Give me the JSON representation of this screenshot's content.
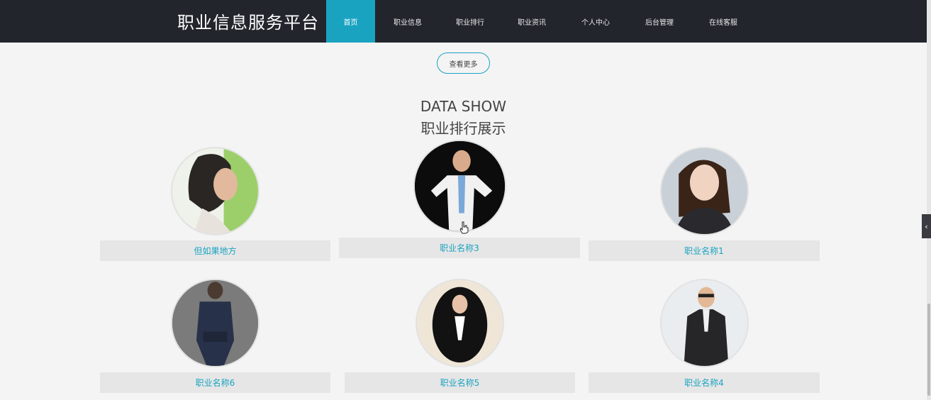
{
  "header": {
    "brand": "职业信息服务平台",
    "nav": [
      "首页",
      "职业信息",
      "职业排行",
      "职业资讯",
      "个人中心",
      "后台管理",
      "在线客服"
    ],
    "active_index": 0
  },
  "main": {
    "more_button": "查看更多",
    "section_title_en": "DATA SHOW",
    "section_title_zh": "职业排行展示",
    "cards": [
      {
        "label": "但如果地方",
        "icon": "person-photo-icon"
      },
      {
        "label": "职业名称3",
        "icon": "person-photo-icon"
      },
      {
        "label": "职业名称1",
        "icon": "person-photo-icon"
      },
      {
        "label": "职业名称6",
        "icon": "person-photo-icon"
      },
      {
        "label": "职业名称5",
        "icon": "person-photo-icon"
      },
      {
        "label": "职业名称4",
        "icon": "person-photo-icon"
      }
    ]
  },
  "colors": {
    "nav_bg": "#23252d",
    "accent": "#1aa3c1",
    "page_bg": "#f4f4f4",
    "label_bg": "#e6e6e6"
  }
}
